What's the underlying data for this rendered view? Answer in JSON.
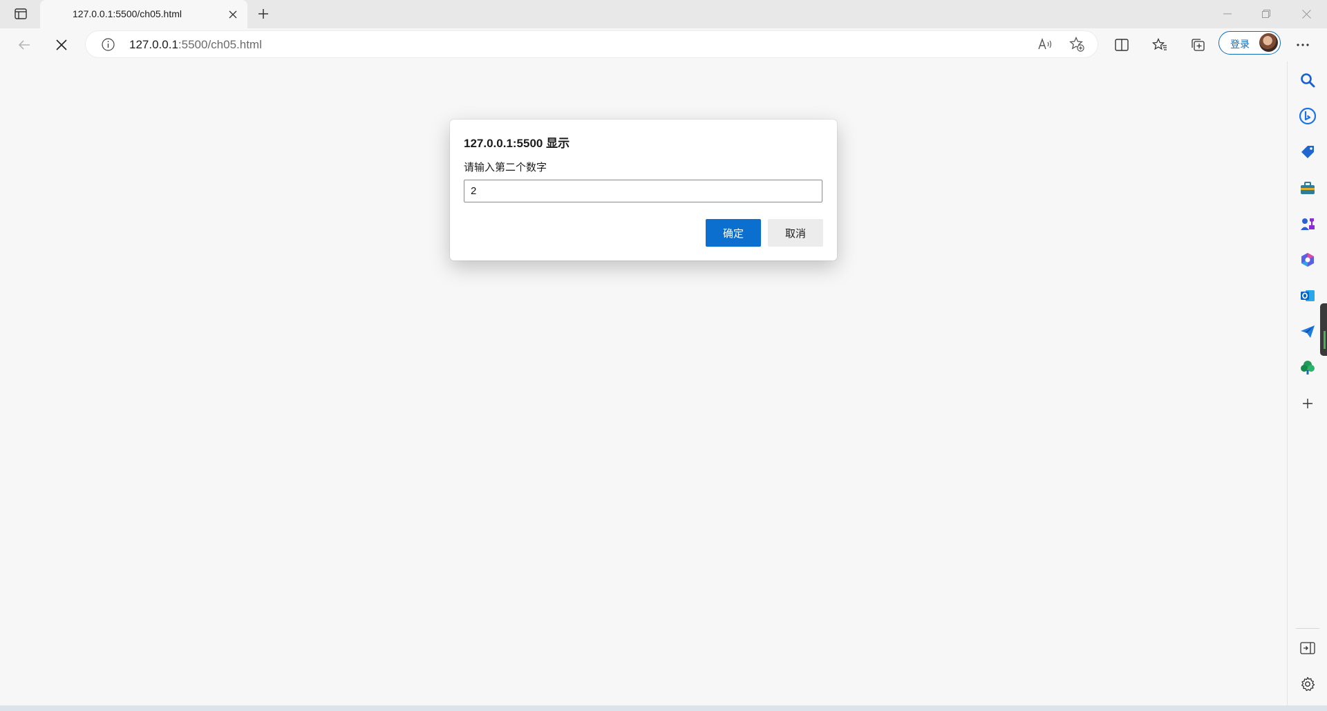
{
  "browser": {
    "tab": {
      "title": "127.0.0.1:5500/ch05.html"
    },
    "address": {
      "host": "127.0.0.1",
      "rest": ":5500/ch05.html"
    },
    "account": {
      "login_label": "登录"
    },
    "sidebar_icons": [
      "search-icon",
      "bing-chat-icon",
      "shopping-tag-icon",
      "tools-icon",
      "games-icon",
      "microsoft-365-icon",
      "outlook-icon",
      "send-icon",
      "tree-icon",
      "add-icon"
    ],
    "sidebar_bottom_icons": [
      "hide-sidebar-icon",
      "settings-icon"
    ]
  },
  "dialog": {
    "title": "127.0.0.1:5500 显示",
    "message": "请输入第二个数字",
    "input_value": "2",
    "ok_label": "确定",
    "cancel_label": "取消"
  },
  "colors": {
    "accent": "#0b6fd0",
    "page_background": "#f7f7f7",
    "tabstrip_background": "#e8e8e8"
  }
}
